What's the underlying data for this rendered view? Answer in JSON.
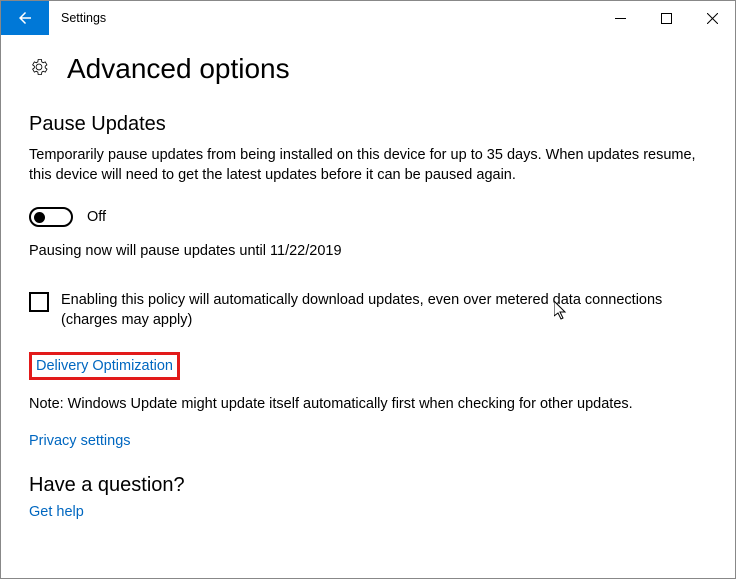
{
  "window": {
    "title": "Settings"
  },
  "header": {
    "title": "Advanced options"
  },
  "pause_section": {
    "title": "Pause Updates",
    "description": "Temporarily pause updates from being installed on this device for up to 35 days. When updates resume, this device will need to get the latest updates before it can be paused again.",
    "toggle_state": "Off",
    "pause_note": "Pausing now will pause updates until 11/22/2019"
  },
  "policy_checkbox": {
    "label": "Enabling this policy will automatically download updates, even over metered data connections (charges may apply)"
  },
  "links": {
    "delivery_optimization": "Delivery Optimization",
    "privacy_settings": "Privacy settings",
    "get_help": "Get help"
  },
  "note": "Note: Windows Update might update itself automatically first when checking for other updates.",
  "question_section": {
    "title": "Have a question?"
  }
}
